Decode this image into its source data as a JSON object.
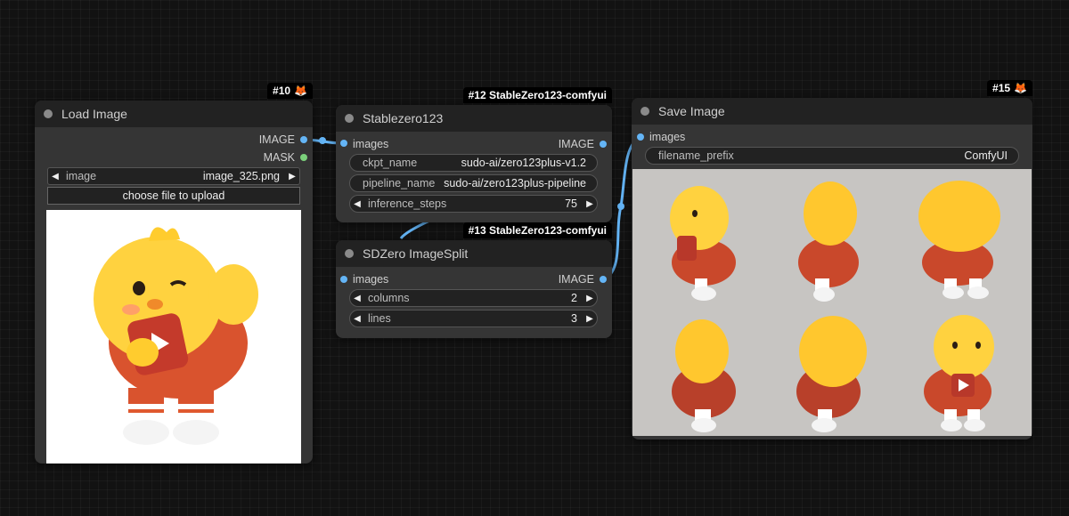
{
  "nodes": {
    "load_image": {
      "title": "Load Image",
      "badge": "#10",
      "outputs": [
        "IMAGE",
        "MASK"
      ],
      "image_widget": {
        "label": "image",
        "value": "image_325.png"
      },
      "upload_label": "choose file to upload"
    },
    "stablezero": {
      "title": "Stablezero123",
      "badge": "#12 StableZero123-comfyui",
      "input": "images",
      "output": "IMAGE",
      "widgets": [
        {
          "label": "ckpt_name",
          "value": "sudo-ai/zero123plus-v1.2"
        },
        {
          "label": "pipeline_name",
          "value": "sudo-ai/zero123plus-pipeline"
        },
        {
          "label": "inference_steps",
          "value": "75"
        }
      ]
    },
    "imagesplit": {
      "title": "SDZero ImageSplit",
      "badge": "#13 StableZero123-comfyui",
      "input": "images",
      "output": "IMAGE",
      "widgets": [
        {
          "label": "columns",
          "value": "2"
        },
        {
          "label": "lines",
          "value": "3"
        }
      ]
    },
    "save_image": {
      "title": "Save Image",
      "badge": "#15",
      "input": "images",
      "widget": {
        "label": "filename_prefix",
        "value": "ComfyUI"
      }
    }
  },
  "colors": {
    "link": "#64b5f6",
    "node_bg": "#353535",
    "header_bg": "#222222",
    "canvas_bg": "#121212",
    "mask_slot": "#7bd17b"
  },
  "icons": {
    "badge_icon": "fox-icon",
    "arrow_left": "arrow-left-icon",
    "arrow_right": "arrow-right-icon"
  }
}
